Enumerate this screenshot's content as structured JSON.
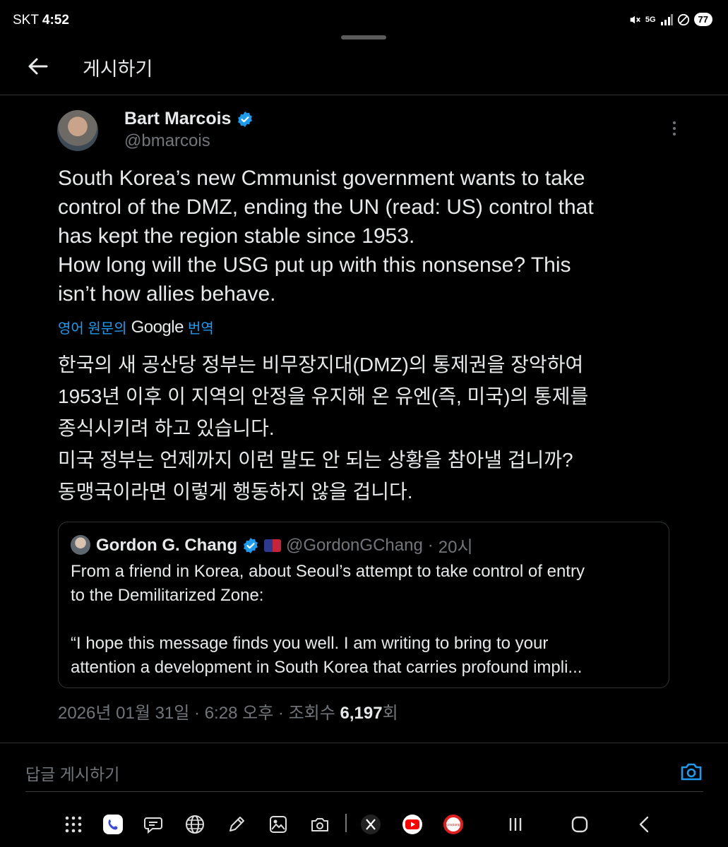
{
  "status_bar": {
    "carrier": "SKT",
    "time": "4:52",
    "network": "5G",
    "battery": "77"
  },
  "header": {
    "title": "게시하기"
  },
  "post": {
    "author_name": "Bart Marcois",
    "author_handle": "@bmarcois",
    "text_en_lines": [
      "South Korea’s new Cmmunist government wants to take",
      "control of the DMZ, ending the UN (read: US) control that",
      "has kept the region stable since 1953.",
      "How long will the USG put up with this nonsense? This",
      "isn’t how allies behave."
    ],
    "translate_prefix": "영어 원문의",
    "translate_brand": "Google",
    "translate_suffix": "번역",
    "text_ko_lines": [
      "한국의 새 공산당 정부는 비무장지대(DMZ)의 통제권을 장악하여",
      "1953년 이후 이 지역의 안정을 유지해 온 유엔(즉, 미국)의 통제를",
      "종식시키려 하고 있습니다.",
      "미국 정부는 언제까지 이런 말도 안 되는 상황을 참아낼 겁니까?",
      "동맹국이라면 이렇게 행동하지 않을 겁니다."
    ],
    "quote": {
      "author_name": "Gordon G. Chang",
      "author_handle": "@GordonGChang",
      "time": "20시",
      "text_lines": [
        "From a friend in Korea, about Seoul’s attempt to take control of entry",
        "to the Demilitarized Zone:",
        "",
        "“I hope this message finds you well. I am writing to bring to your",
        "attention a development in South Korea that carries profound impli..."
      ]
    },
    "date": "2026년 01월 31일",
    "clock": "6:28 오후",
    "views_label": "조회수",
    "views_count": "6,197",
    "views_suffix": "회"
  },
  "reply": {
    "placeholder": "답글 게시하기"
  },
  "taskbar": {
    "apps": [
      "apps-grid-icon",
      "phone-icon",
      "messages-icon",
      "browser-icon",
      "pen-icon",
      "gallery-icon",
      "camera-icon",
      "x-icon",
      "youtube-icon",
      "coupang-icon"
    ],
    "coupang_label": "coupang",
    "nav": [
      "recents-icon",
      "home-icon",
      "back-nav-icon"
    ]
  },
  "colors": {
    "background": "#000000",
    "text": "#e7e9ea",
    "muted": "#71767b",
    "link": "#1d9bf0",
    "border": "#2f3336"
  }
}
